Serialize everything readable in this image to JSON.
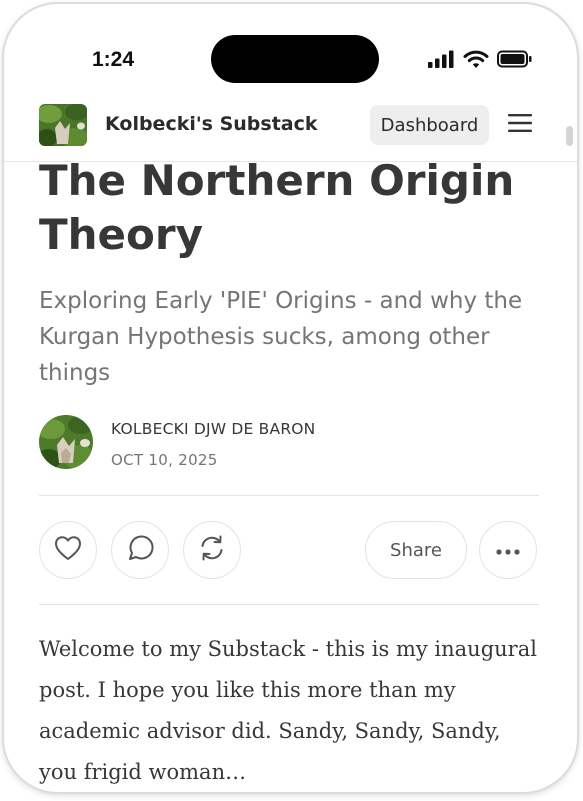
{
  "status_bar": {
    "time": "1:24",
    "icons": [
      "cellular-signal-icon",
      "wifi-icon",
      "battery-icon"
    ]
  },
  "header": {
    "publication_name": "Kolbecki's Substack",
    "dashboard_label": "Dashboard",
    "logo_icon": "publication-logo-image",
    "menu_icon": "hamburger-menu-icon"
  },
  "post": {
    "title": "The Northern Origin Theory",
    "subtitle": "Exploring Early 'PIE' Origins - and why the Kurgan Hypothesis sucks, among other things",
    "author": "KOLBECKI DJW DE BARON",
    "date": "OCT 10, 2025",
    "body": "Welcome to my Substack - this is my inaugural post. I hope you like this more than my academic advisor did. Sandy, Sandy, Sandy, you frigid woman…"
  },
  "actions": {
    "like_icon": "heart-icon",
    "comment_icon": "comment-icon",
    "restack_icon": "restack-icon",
    "share_label": "Share",
    "more_icon": "more-options-icon"
  },
  "colors": {
    "text": "#363737",
    "secondary_text": "#757575",
    "divider": "#e3e3e3",
    "button_bg": "#eeeeee",
    "island": "#000000"
  }
}
